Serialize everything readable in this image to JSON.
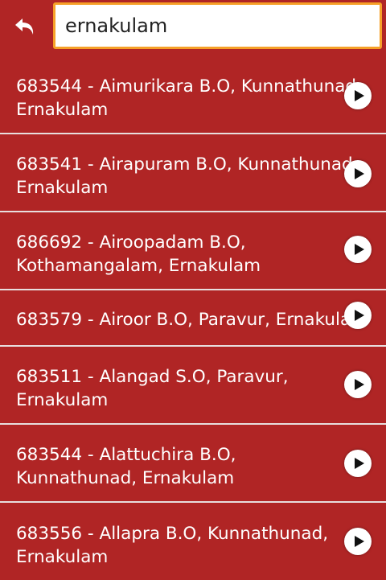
{
  "search": {
    "value": "ernakulam",
    "back_icon": "back-arrow-icon"
  },
  "results": [
    {
      "text": "683544 - Aimurikara B.O, Kunnathunad, Ernakulam",
      "icon": "play-icon"
    },
    {
      "text": "683541 - Airapuram B.O, Kunnathunad, Ernakulam",
      "icon": "play-icon"
    },
    {
      "text": "686692 - Airoopadam B.O, Kothamangalam, Ernakulam",
      "icon": "play-icon"
    },
    {
      "text": "683579 - Airoor B.O, Paravur, Ernakulam",
      "icon": "play-icon"
    },
    {
      "text": "683511 - Alangad S.O, Paravur, Ernakulam",
      "icon": "play-icon"
    },
    {
      "text": "683544 - Alattuchira B.O, Kunnathunad, Ernakulam",
      "icon": "play-icon"
    },
    {
      "text": "683556 - Allapra B.O, Kunnathunad, Ernakulam",
      "icon": "play-icon"
    }
  ],
  "colors": {
    "background": "#b02525",
    "divider": "#e8dede",
    "search_border": "#f6a028",
    "text": "#ffffff"
  }
}
